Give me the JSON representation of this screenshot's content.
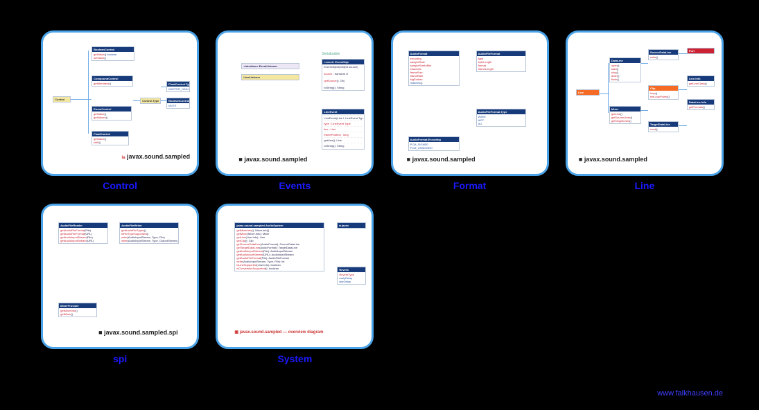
{
  "footer_url": "www.falkhausen.de",
  "pkg_main": "javax.sound.sampled",
  "pkg_spi": "javax.sound.sampled.spi",
  "tiles": [
    {
      "caption": "Control"
    },
    {
      "caption": "Events"
    },
    {
      "caption": "Format"
    },
    {
      "caption": "Line"
    },
    {
      "caption": "spi"
    },
    {
      "caption": "System"
    }
  ],
  "events": {
    "iface": "EventListener",
    "listener": "LineListener",
    "evtobj": "EventObje",
    "lineevt": "LineEvent",
    "serial": "Serializable"
  },
  "format": {
    "b1": "AudioFormat",
    "b2": "AudioFormat.Encoding",
    "b3": "AudioFileFormat",
    "b4": "AudioFileFormat.Type"
  },
  "line": {
    "root": "Line",
    "dl": "DataLine",
    "mixer": "Mixer",
    "sdl": "SourceDataLine",
    "clip": "Clip",
    "tdl": "TargetDataLine",
    "port": "Port",
    "info": "Line.Info"
  },
  "spi": {
    "b1": "AudioFileReader",
    "b2": "AudioFileWriter",
    "b3": "MixerProvider"
  },
  "system": {
    "b1": "AudioSystem",
    "b2": "Reverb",
    "b3": "javax"
  },
  "control": {
    "root": "Control",
    "bc": "BooleanControl",
    "cc": "CompoundControl",
    "ec": "EnumControl",
    "fc": "FloatControl",
    "type": "Control.Type"
  }
}
